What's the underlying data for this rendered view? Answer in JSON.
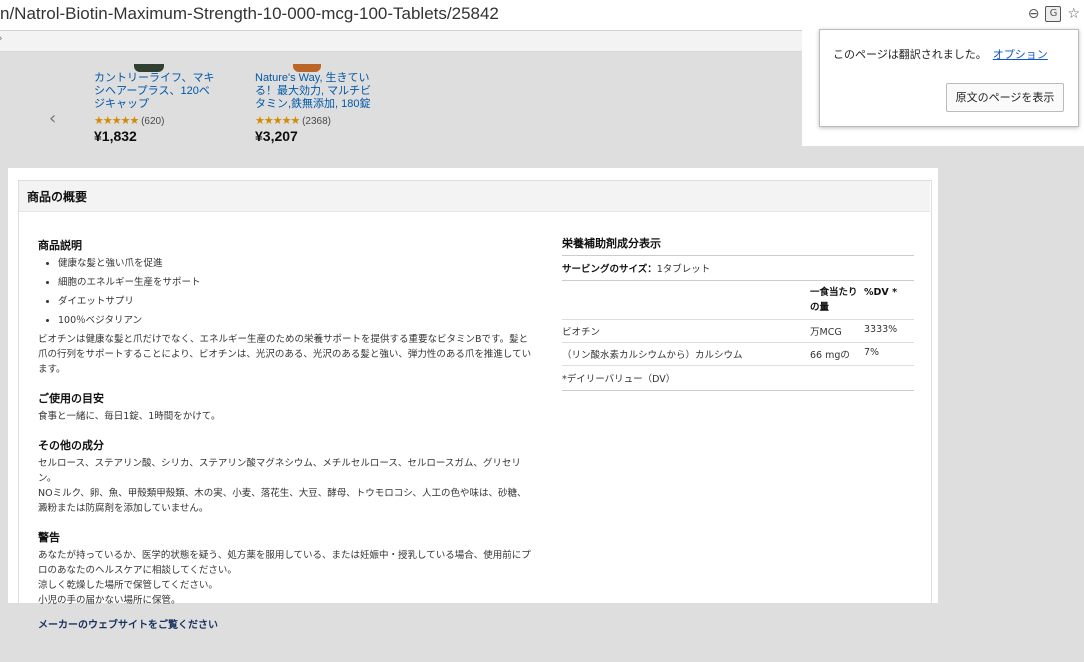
{
  "browser": {
    "url": "n/Natrol-Biotin-Maximum-Strength-10-000-mcg-100-Tablets/25842"
  },
  "products": [
    {
      "name": "カントリーライフ、マキシヘアープラス、120ベジキャップ",
      "review_count": "(620)",
      "price": "¥1,832",
      "rating": 4.5
    },
    {
      "name": "Nature's Way, 生きている！最大効力, マルチビタミン,鉄無添加, 180錠",
      "review_count": "(2368)",
      "price": "¥3,207",
      "rating": 4.5
    }
  ],
  "translate_popup": {
    "message": "このページは翻訳されました。",
    "options_link": "オプション",
    "show_original_button": "原文のページを表示"
  },
  "overview": {
    "title": "商品の概要",
    "description": {
      "heading": "商品説明",
      "bullets": [
        "健康な髪と強い爪を促進",
        "細胞のエネルギー生産をサポート",
        "ダイエットサプリ",
        "100％ベジタリアン"
      ],
      "paragraph": "ビオチンは健康な髪と爪だけでなく、エネルギー生産のための栄養サポートを提供する重要なビタミンBです。髪と爪の行列をサポートすることにより、ビオチンは、光沢のある、光沢のある髪と強い、弾力性のある爪を推進しています。"
    },
    "usage": {
      "heading": "ご使用の目安",
      "text": "食事と一緒に、毎日1錠、1時間をかけて。"
    },
    "other_ingredients": {
      "heading": "その他の成分",
      "text1": "セルロース、ステアリン酸、シリカ、ステアリン酸マグネシウム、メチルセルロース、セルロースガム、グリセリン。",
      "text2": "NOミルク、卵、魚、甲殻類甲殻類、木の実、小麦、落花生、大豆、酵母、トウモロコシ、人工の色や味は、砂糖、澱粉または防腐剤を添加していません。"
    },
    "warning": {
      "heading": "警告",
      "lines": [
        "あなたが持っているか、医学的状態を疑う、処方薬を服用している、または妊娠中・授乳している場合、使用前にプロのあなたのヘルスケアに相談してください。",
        "涼しく乾燥した場所で保管してください。",
        "小児の手の届かない場所に保管。"
      ]
    },
    "maker_link": "メーカーのウェブサイトをご覧ください"
  },
  "nutrition": {
    "title": "栄養補助剤成分表示",
    "serving_label": "サービングのサイズ：",
    "serving_value": "1タブレット",
    "col_amount": "一食当たりの量",
    "col_dv": "%DV *",
    "rows": [
      {
        "name": "ビオチン",
        "amount": "万MCG",
        "dv": "3333%"
      },
      {
        "name": "（リン酸水素カルシウムから）カルシウム",
        "amount": "66 mgの",
        "dv": "7%"
      }
    ],
    "footnote": "*デイリーバリュー（DV）"
  }
}
